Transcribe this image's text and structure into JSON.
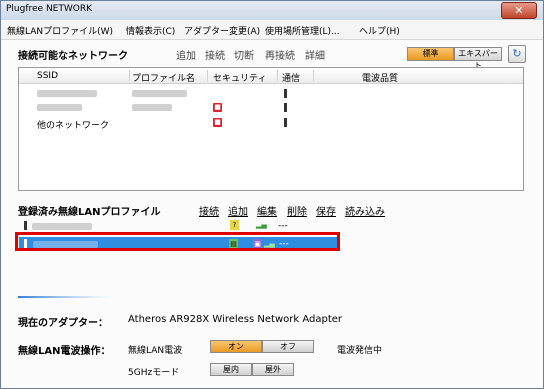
{
  "window": {
    "title": "Plugfree NETWORK",
    "close_glyph": "✕"
  },
  "menu": [
    "無線LANプロファイル(W)",
    "情報表示(C)",
    "アダプター変更(A)",
    "使用場所管理(L)...",
    "ヘルプ(H)"
  ],
  "networks": {
    "title": "接続可能なネットワーク",
    "actions": [
      "追加",
      "接続",
      "切断",
      "再接続",
      "詳細"
    ],
    "view_modes": [
      "標準",
      "エキスパート"
    ],
    "refresh_icon": "refresh-icon",
    "columns": [
      "SSID",
      "プロファイル名",
      "セキュリティ",
      "通信",
      "電波品質"
    ],
    "rows": [
      {
        "ssid": "",
        "profile": "",
        "secured": false
      },
      {
        "ssid": "",
        "profile": "",
        "secured": true
      },
      {
        "ssid": "他のネットワーク",
        "profile": "",
        "secured": true
      }
    ],
    "lock_glyph": "🔒"
  },
  "profiles": {
    "title": "登録済み無線LANプロファイル",
    "actions": [
      "接続",
      "追加",
      "編集",
      "削除",
      "保存",
      "読み込み"
    ],
    "rows": [
      {
        "name": "",
        "quality": "---",
        "selected": false
      },
      {
        "name": "",
        "quality": "---",
        "selected": true
      }
    ]
  },
  "adapter": {
    "label": "現在のアダプター：",
    "value": "Atheros AR928X Wireless Network Adapter"
  },
  "radio": {
    "label": "無線LAN電波操作：",
    "wlan_label": "無線LAN電波",
    "on": "オン",
    "off": "オフ",
    "status": "電波発信中",
    "ghz_label": "5GHzモード",
    "indoor": "屋内",
    "outdoor": "屋外"
  },
  "colors": {
    "accent": "#e99a22",
    "selection": "#2f8ee0",
    "highlight_box": "#e00000",
    "lock": "#e0202a"
  }
}
